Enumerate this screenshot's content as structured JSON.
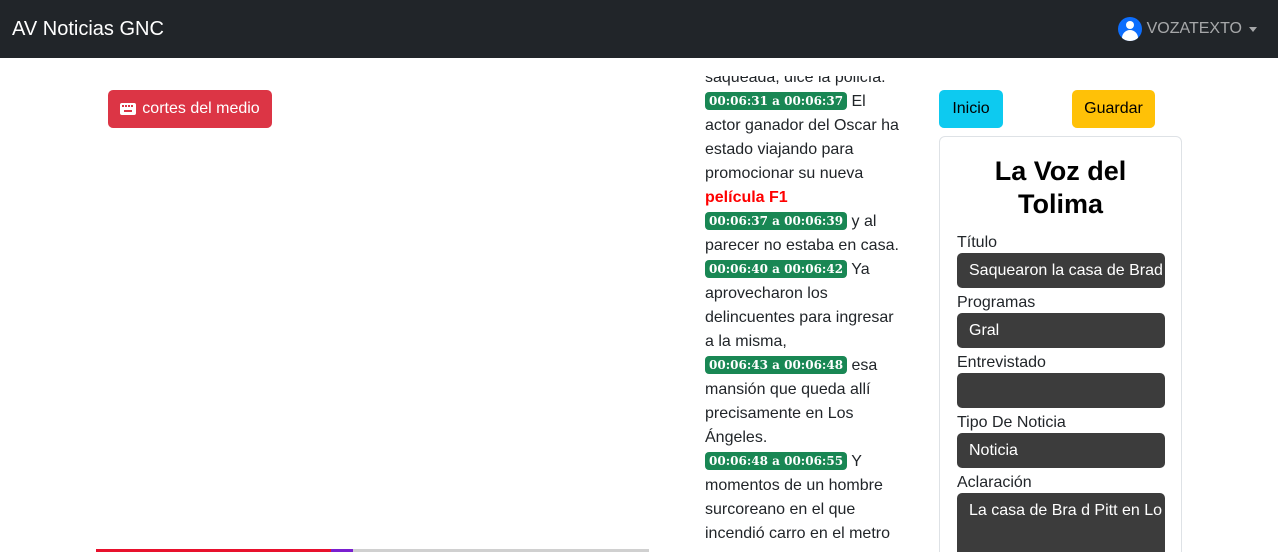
{
  "navbar": {
    "brand": "AV Noticias GNC",
    "user": "VOZATEXTO"
  },
  "left": {
    "cortes_button": "cortes del medio",
    "progress": {
      "played_fraction": 0.425,
      "knob_fraction": 0.425
    }
  },
  "transcript": {
    "lead_text": "saqueada, dice la policía.",
    "segments": [
      {
        "time": "00:06:31 a 00:06:37",
        "text": "El actor ganador del Oscar ha estado viajando para promocionar su nueva",
        "highlight": "película F1"
      },
      {
        "time": "00:06:37 a 00:06:39",
        "text": "y al parecer no estaba en casa."
      },
      {
        "time": "00:06:40 a 00:06:42",
        "text": "Ya aprovecharon los delincuentes para ingresar a la misma,"
      },
      {
        "time": "00:06:43 a 00:06:48",
        "text": "esa mansión que queda allí precisamente en Los Ángeles."
      },
      {
        "time": "00:06:48 a 00:06:55",
        "text": "Y momentos de un hombre surcoreano en el que incendió carro en el metro"
      }
    ]
  },
  "actions": {
    "inicio": "Inicio",
    "guardar": "Guardar"
  },
  "form": {
    "title": "La Voz del Tolima",
    "fields": [
      {
        "label": "Título",
        "value": "Saquearon la casa de Brad"
      },
      {
        "label": "Programas",
        "value": "Gral"
      },
      {
        "label": "Entrevistado",
        "value": ""
      },
      {
        "label": "Tipo De Noticia",
        "value": "Noticia"
      },
      {
        "label": "Aclaración",
        "value": "La casa de Bra d Pitt en Lo"
      }
    ]
  },
  "colors": {
    "navbar_bg": "#212529",
    "danger": "#dc3545",
    "info": "#0dcaf0",
    "warning": "#ffc107",
    "timestamp_badge": "#198754",
    "highlight_text": "#ff0000",
    "input_bg": "#3c3c3c"
  },
  "icons": {
    "cortes_button_icon": "keyboard-icon",
    "user_icon": "person-circle-icon",
    "user_menu_caret": "caret-down-icon"
  }
}
